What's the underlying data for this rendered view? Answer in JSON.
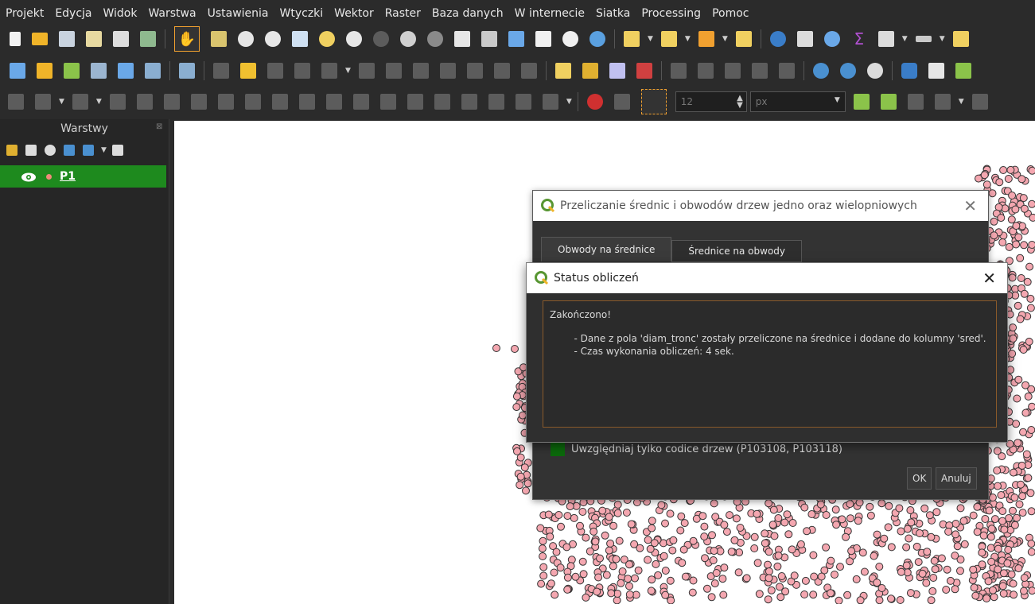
{
  "menu": [
    "Projekt",
    "Edycja",
    "Widok",
    "Warstwa",
    "Ustawienia",
    "Wtyczki",
    "Wektor",
    "Raster",
    "Baza danych",
    "W internecie",
    "Siatka",
    "Processing",
    "Pomoc"
  ],
  "toolbar3": {
    "size_value": "12",
    "unit_value": "px"
  },
  "layers_panel": {
    "title": "Warstwy",
    "layer_name": "P1"
  },
  "dialog_main": {
    "title": "Przeliczanie średnic i obwodów drzew jedno oraz wielopniowych",
    "tabs": [
      "Obwody na średnice",
      "Średnice na obwody"
    ],
    "checkbox_label": "Uwzględniaj tylko codice drzew (P103108, P103118)",
    "ok_label": "OK",
    "cancel_label": "Anuluj"
  },
  "dialog_status": {
    "title": "Status obliczeń",
    "message_title": "Zakończono!",
    "line1": "        - Dane z pola 'diam_tronc' zostały przeliczone na średnice i dodane do kolumny 'sred'.",
    "line2": "        - Czas wykonania obliczeń: 4 sek."
  },
  "colors": {
    "accent_green": "#1e8a1e",
    "point_fill": "#f4a7b0",
    "point_stroke": "#333333"
  }
}
